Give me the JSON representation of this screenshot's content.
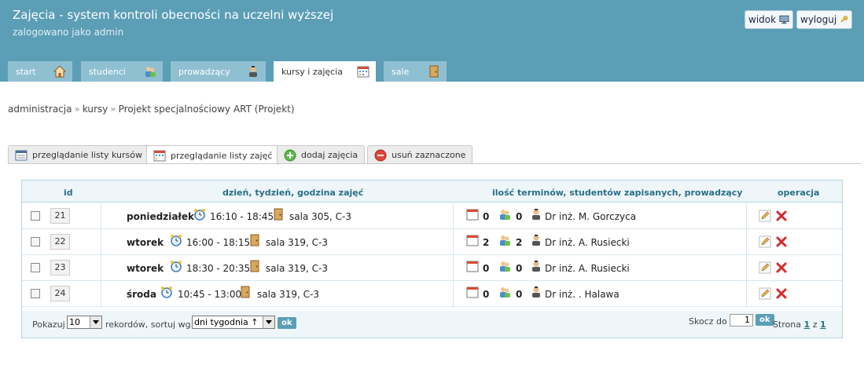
{
  "header": {
    "title": "Zajęcia - system kontroli obecności na uczelni wyższej",
    "subtitle": "zalogowano jako admin",
    "view_label": "widok",
    "logout_label": "wyloguj"
  },
  "nav": {
    "tabs": [
      {
        "label": "start",
        "icon": "house-icon"
      },
      {
        "label": "studenci",
        "icon": "users-icon"
      },
      {
        "label": "prowadzący",
        "icon": "teacher-icon"
      },
      {
        "label": "kursy i zajęcia",
        "icon": "calendar-icon",
        "active": true
      },
      {
        "label": "sale",
        "icon": "door-icon"
      }
    ]
  },
  "breadcrumb": {
    "items": [
      "administracja",
      "kursy",
      "Projekt specjalnościowy ART (Projekt)"
    ],
    "separator": "»"
  },
  "actions": {
    "tabs": [
      {
        "label": "przeglądanie listy kursów",
        "icon": "list-icon"
      },
      {
        "label": "przeglądanie listy zajęć",
        "icon": "calendar-icon",
        "active": true
      },
      {
        "label": "dodaj zajęcia",
        "icon": "plus-icon"
      },
      {
        "label": "usuń zaznaczone",
        "icon": "minus-icon"
      }
    ]
  },
  "table": {
    "columns": {
      "id": "id",
      "schedule": "dzień, tydzień, godzina zajęć",
      "stats": "ilość terminów, studentów zapisanych, prowadzący",
      "ops": "operacja"
    },
    "rows": [
      {
        "id": "21",
        "day": "poniedziałek",
        "time": "16:10 - 18:45",
        "room": "sala 305, C-3",
        "terms": "0",
        "students": "0",
        "teacher": "Dr inż. M. Gorczyca"
      },
      {
        "id": "22",
        "day": "wtorek",
        "time": "16:00 - 18:15",
        "room": "sala 319, C-3",
        "terms": "2",
        "students": "2",
        "teacher": "Dr inż. A. Rusiecki"
      },
      {
        "id": "23",
        "day": "wtorek",
        "time": "18:30 - 20:35",
        "room": "sala 319, C-3",
        "terms": "0",
        "students": "0",
        "teacher": "Dr inż. A. Rusiecki"
      },
      {
        "id": "24",
        "day": "środa",
        "time": "10:45 - 13:00",
        "room": "sala 319, C-3",
        "terms": "0",
        "students": "0",
        "teacher": "Dr inż. . Halawa"
      }
    ]
  },
  "footer": {
    "show_label": "Pokazuj",
    "page_size": "10",
    "records_sort_label": "rekordów, sortuj wg.",
    "sort_value": "dni tygodnia ↑",
    "ok_label": "ok",
    "jump_label": "Skocz do",
    "jump_value": "1",
    "page_prefix": "Strona",
    "page_current": "1",
    "page_of": "z",
    "page_total": "1"
  },
  "colors": {
    "header_bg": "#5b9eb6",
    "tab_bg": "#8fc0d2",
    "accent": "#2a6e8a"
  }
}
